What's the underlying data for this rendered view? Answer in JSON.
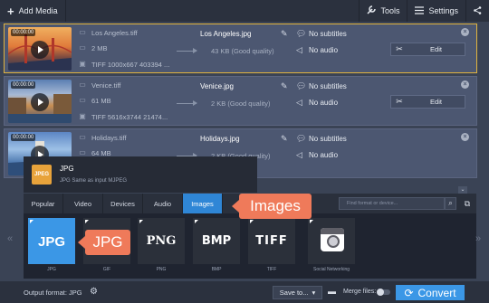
{
  "toolbar": {
    "add_media_label": "Add Media",
    "tools_label": "Tools",
    "settings_label": "Settings"
  },
  "files": [
    {
      "duration": "00:00:00",
      "name": "Los Angeles.tiff",
      "size": "2 MB",
      "meta": "TIFF 1000x667 403394 ...",
      "output_name": "Los Angeles.jpg",
      "output_size": "43 KB (Good quality)",
      "subtitles": "No subtitles",
      "audio": "No audio",
      "edit_label": "Edit",
      "selected": true
    },
    {
      "duration": "00:00:00",
      "name": "Venice.tiff",
      "size": "61 MB",
      "meta": "TIFF 5616x3744 21474...",
      "output_name": "Venice.jpg",
      "output_size": "2 KB (Good quality)",
      "subtitles": "No subtitles",
      "audio": "No audio",
      "edit_label": "Edit",
      "selected": false
    },
    {
      "duration": "00:00:00",
      "name": "Holidays.tiff",
      "size": "64 MB",
      "meta": "",
      "output_name": "Holidays.jpg",
      "output_size": "2 KB (Good quality)",
      "subtitles": "No subtitles",
      "audio": "No audio",
      "edit_label": "",
      "selected": false
    }
  ],
  "popup": {
    "icon_text": "JPEG",
    "title": "JPG",
    "subtitle": "JPG    Same as input    MJPEG"
  },
  "tabs": [
    {
      "label": "Popular",
      "selected": false
    },
    {
      "label": "Video",
      "selected": false
    },
    {
      "label": "Devices",
      "selected": false
    },
    {
      "label": "Audio",
      "selected": false
    },
    {
      "label": "Images",
      "selected": true
    }
  ],
  "search": {
    "placeholder": "Find format or device..."
  },
  "formats": [
    {
      "label": "JPG",
      "name": "JPG"
    },
    {
      "label": "PNG",
      "name": "GIF"
    },
    {
      "label": "BMP",
      "name": "PNG"
    },
    {
      "label": "TIFF",
      "name": "BMP"
    },
    {
      "label": "",
      "name": "TIFF"
    },
    {
      "label": "",
      "name": "Social Networking"
    }
  ],
  "callouts": {
    "images": "Images",
    "jpg": "JPG"
  },
  "bottom": {
    "output_format": "Output format: JPG",
    "save_to": "Save to...",
    "merge_files": "Merge files:",
    "convert": "Convert"
  },
  "colors": {
    "accent": "#3b97e6",
    "callout": "#ef7a5a",
    "selected_border": "#e1b43f"
  }
}
